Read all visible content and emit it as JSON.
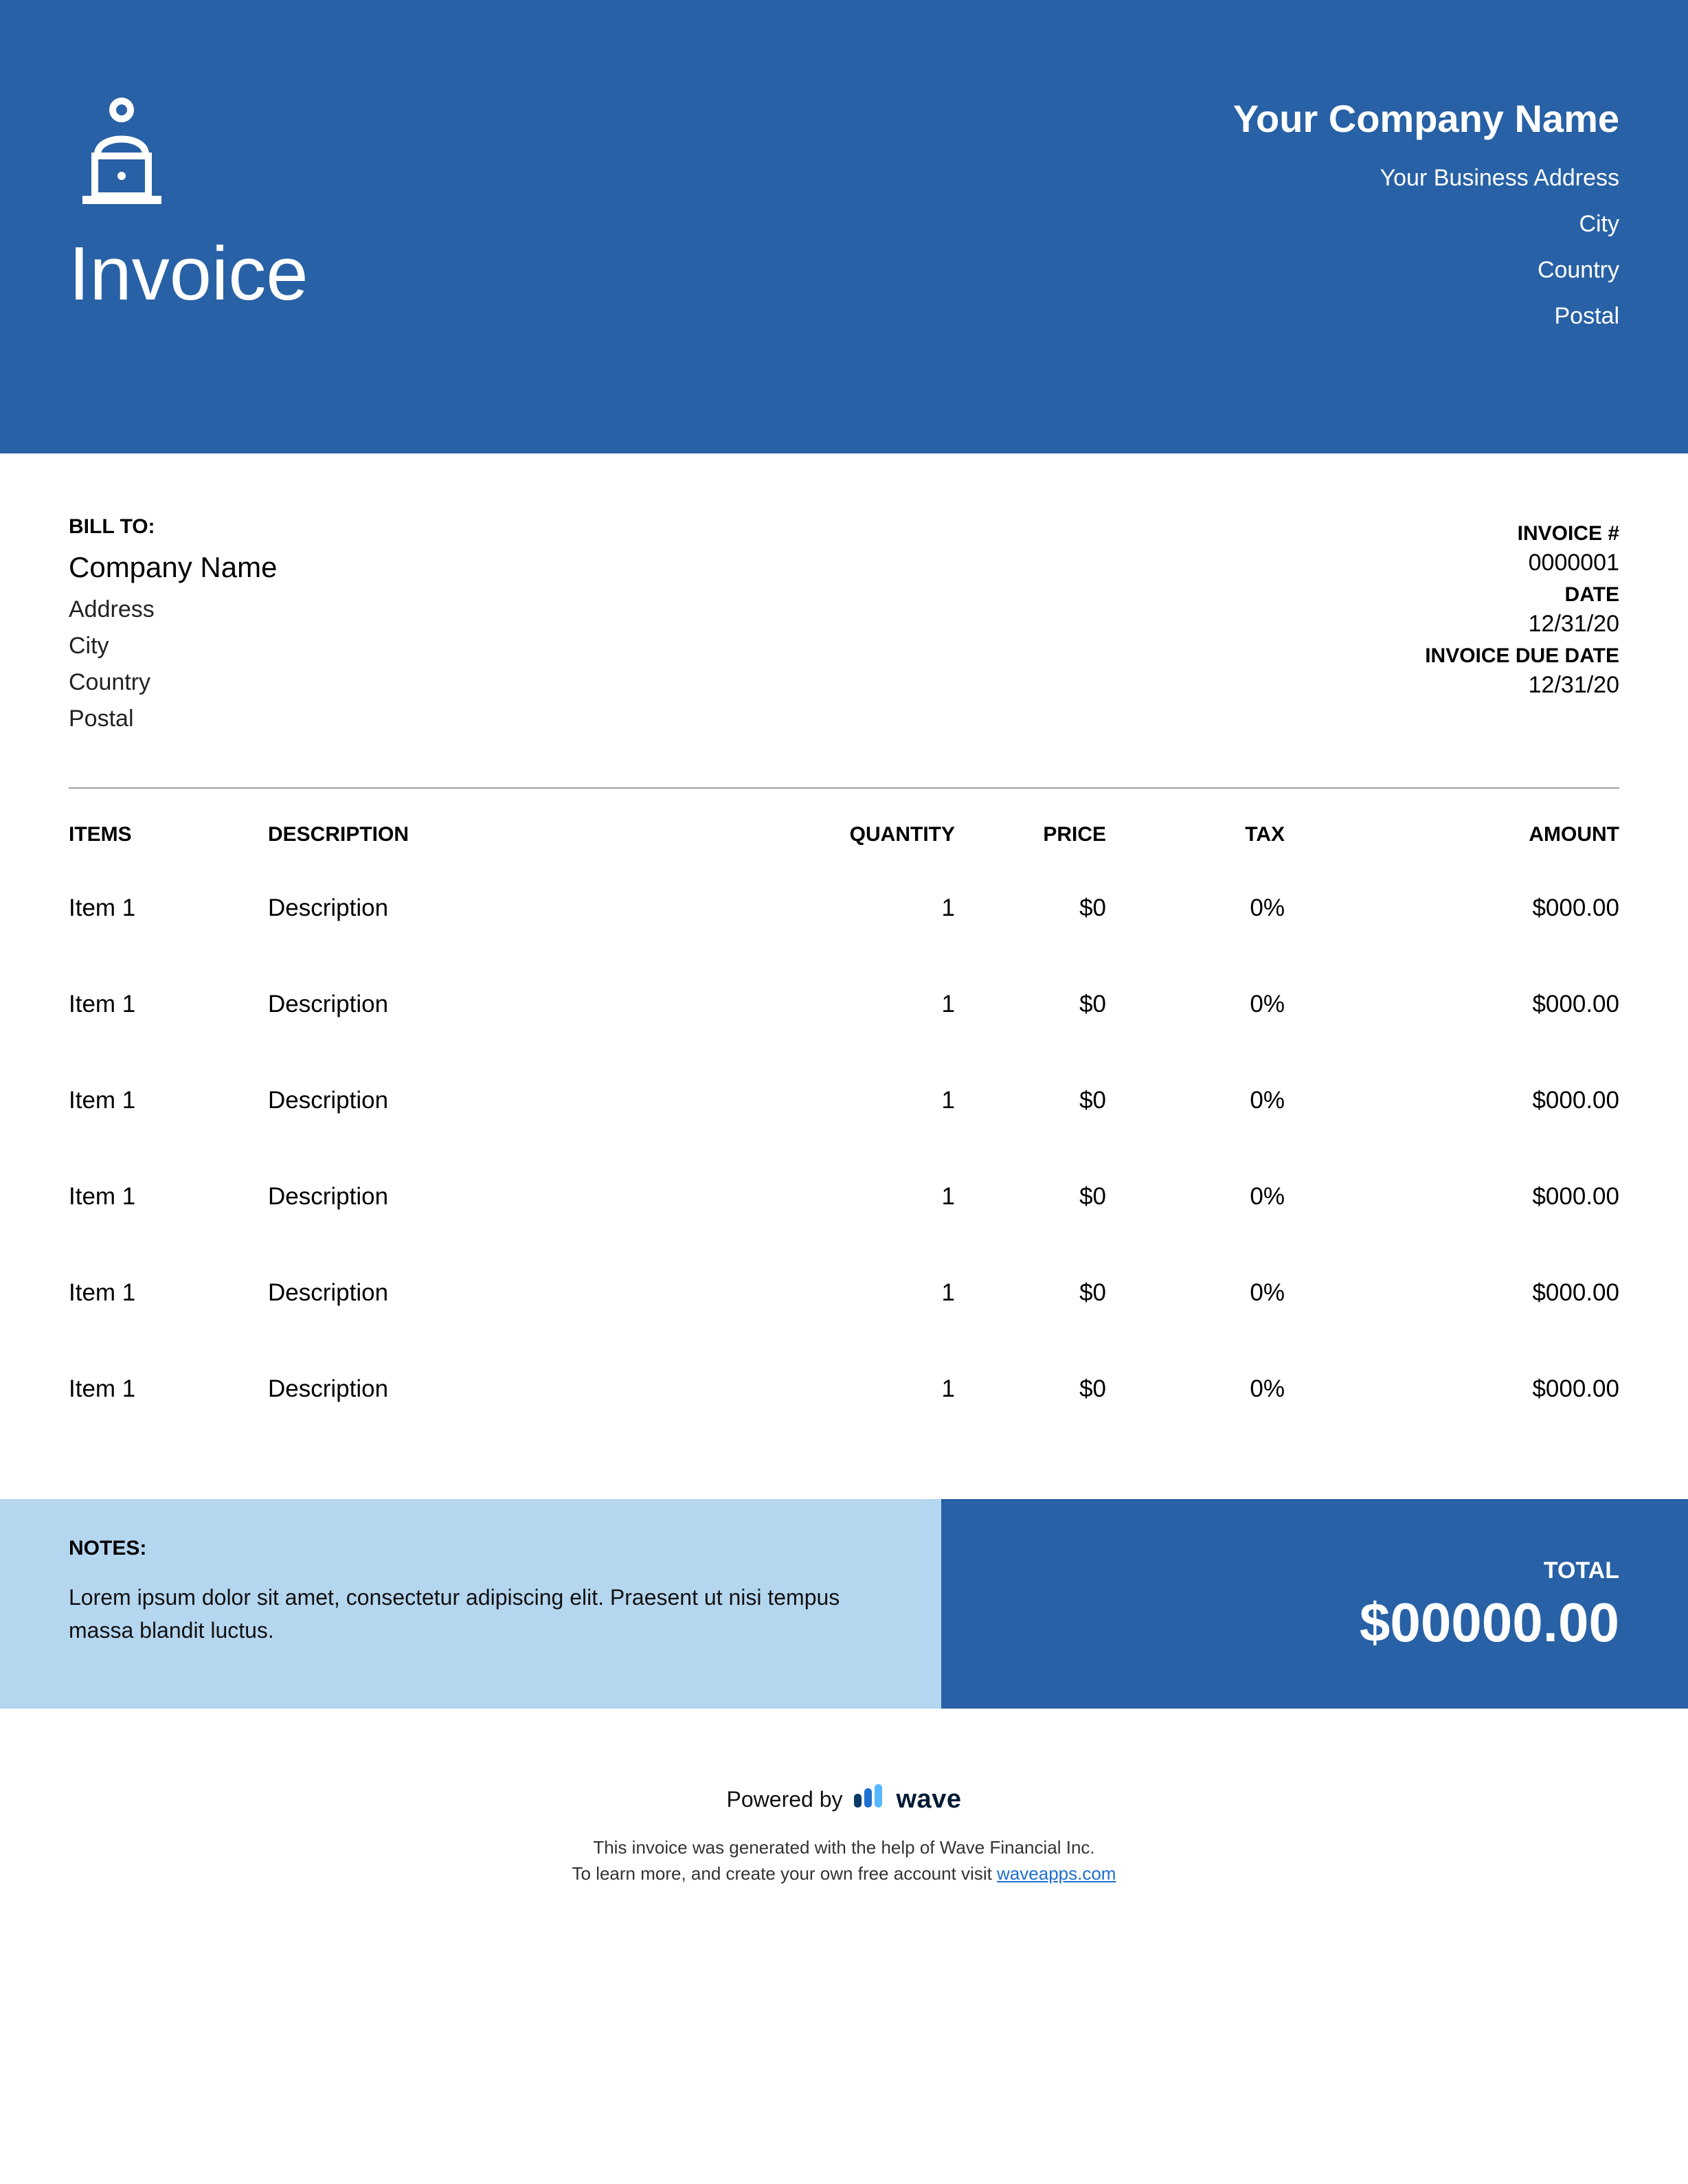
{
  "header": {
    "doc_title": "Invoice",
    "company_name": "Your Company Name",
    "address": "Your Business Address",
    "city": "City",
    "country": "Country",
    "postal": "Postal"
  },
  "bill_to": {
    "label": "BILL TO:",
    "company": "Company Name",
    "address": "Address",
    "city": "City",
    "country": "Country",
    "postal": "Postal"
  },
  "invoice_meta": {
    "number_label": "INVOICE #",
    "number": "0000001",
    "date_label": "DATE",
    "date": "12/31/20",
    "due_label": "INVOICE DUE DATE",
    "due": "12/31/20"
  },
  "columns": {
    "items": "ITEMS",
    "description": "DESCRIPTION",
    "quantity": "QUANTITY",
    "price": "PRICE",
    "tax": "TAX",
    "amount": "AMOUNT"
  },
  "rows": [
    {
      "item": "Item 1",
      "description": "Description",
      "quantity": "1",
      "price": "$0",
      "tax": "0%",
      "amount": "$000.00"
    },
    {
      "item": "Item 1",
      "description": "Description",
      "quantity": "1",
      "price": "$0",
      "tax": "0%",
      "amount": "$000.00"
    },
    {
      "item": "Item 1",
      "description": "Description",
      "quantity": "1",
      "price": "$0",
      "tax": "0%",
      "amount": "$000.00"
    },
    {
      "item": "Item 1",
      "description": "Description",
      "quantity": "1",
      "price": "$0",
      "tax": "0%",
      "amount": "$000.00"
    },
    {
      "item": "Item 1",
      "description": "Description",
      "quantity": "1",
      "price": "$0",
      "tax": "0%",
      "amount": "$000.00"
    },
    {
      "item": "Item 1",
      "description": "Description",
      "quantity": "1",
      "price": "$0",
      "tax": "0%",
      "amount": "$000.00"
    }
  ],
  "notes": {
    "label": "NOTES:",
    "text": "Lorem ipsum dolor sit amet, consectetur adipiscing elit. Praesent ut nisi tempus massa blandit luctus."
  },
  "total": {
    "label": "TOTAL",
    "value": "$00000.00"
  },
  "powered": {
    "prefix": "Powered by",
    "brand": "wave",
    "line1": "This invoice was generated with the help of Wave Financial Inc.",
    "line2_a": "To learn more, and create your own free account visit ",
    "link_text": "waveapps.com"
  }
}
